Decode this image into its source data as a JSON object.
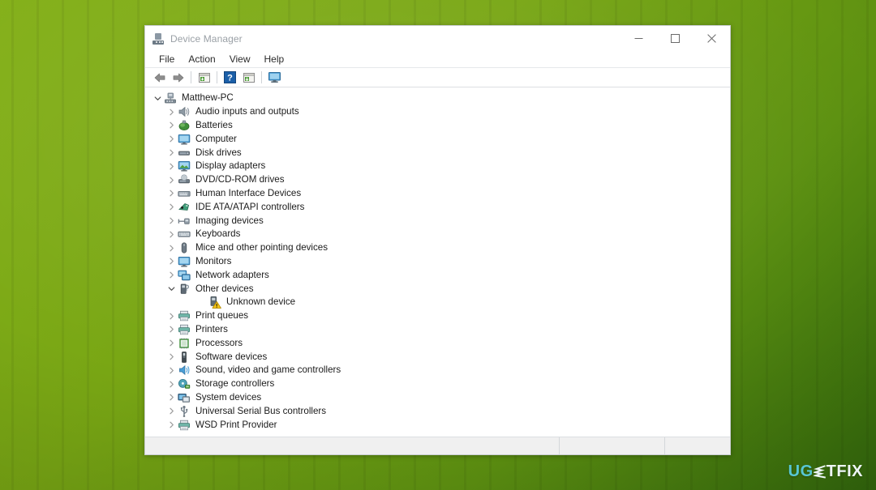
{
  "window": {
    "title": "Device Manager",
    "title_icon": "device-manager-icon",
    "controls": {
      "minimize": "minimize-button",
      "maximize": "maximize-button",
      "close": "close-button"
    }
  },
  "menubar": {
    "items": [
      {
        "label": "File"
      },
      {
        "label": "Action"
      },
      {
        "label": "View"
      },
      {
        "label": "Help"
      }
    ]
  },
  "toolbar": {
    "buttons": [
      {
        "name": "back-arrow-icon",
        "tooltip": "Back"
      },
      {
        "name": "forward-arrow-icon",
        "tooltip": "Forward"
      },
      {
        "name": "properties-icon",
        "tooltip": "Properties"
      },
      {
        "name": "help-icon",
        "tooltip": "Help"
      },
      {
        "name": "update-driver-icon",
        "tooltip": "Update Driver Software"
      },
      {
        "name": "scan-hardware-changes-icon",
        "tooltip": "Scan for hardware changes"
      }
    ]
  },
  "tree": {
    "root": {
      "label": "Matthew-PC",
      "icon": "computer-root-icon",
      "expanded": true
    },
    "items": [
      {
        "label": "Audio inputs and outputs",
        "icon": "speaker-icon",
        "depth": 1,
        "expandable": true,
        "expanded": false
      },
      {
        "label": "Batteries",
        "icon": "battery-icon",
        "depth": 1,
        "expandable": true,
        "expanded": false
      },
      {
        "label": "Computer",
        "icon": "monitor-icon",
        "depth": 1,
        "expandable": true,
        "expanded": false
      },
      {
        "label": "Disk drives",
        "icon": "disk-drive-icon",
        "depth": 1,
        "expandable": true,
        "expanded": false
      },
      {
        "label": "Display adapters",
        "icon": "display-adapter-icon",
        "depth": 1,
        "expandable": true,
        "expanded": false
      },
      {
        "label": "DVD/CD-ROM drives",
        "icon": "dvd-drive-icon",
        "depth": 1,
        "expandable": true,
        "expanded": false
      },
      {
        "label": "Human Interface Devices",
        "icon": "hid-icon",
        "depth": 1,
        "expandable": true,
        "expanded": false
      },
      {
        "label": "IDE ATA/ATAPI controllers",
        "icon": "ide-controller-icon",
        "depth": 1,
        "expandable": true,
        "expanded": false
      },
      {
        "label": "Imaging devices",
        "icon": "imaging-device-icon",
        "depth": 1,
        "expandable": true,
        "expanded": false
      },
      {
        "label": "Keyboards",
        "icon": "keyboard-icon",
        "depth": 1,
        "expandable": true,
        "expanded": false
      },
      {
        "label": "Mice and other pointing devices",
        "icon": "mouse-icon",
        "depth": 1,
        "expandable": true,
        "expanded": false
      },
      {
        "label": "Monitors",
        "icon": "monitor-icon",
        "depth": 1,
        "expandable": true,
        "expanded": false
      },
      {
        "label": "Network adapters",
        "icon": "network-adapter-icon",
        "depth": 1,
        "expandable": true,
        "expanded": false
      },
      {
        "label": "Other devices",
        "icon": "other-device-icon",
        "depth": 1,
        "expandable": true,
        "expanded": true
      },
      {
        "label": "Unknown device",
        "icon": "unknown-device-warning-icon",
        "depth": 2,
        "expandable": false,
        "expanded": false
      },
      {
        "label": "Print queues",
        "icon": "printer-icon",
        "depth": 1,
        "expandable": true,
        "expanded": false
      },
      {
        "label": "Printers",
        "icon": "printer-icon",
        "depth": 1,
        "expandable": true,
        "expanded": false
      },
      {
        "label": "Processors",
        "icon": "processor-icon",
        "depth": 1,
        "expandable": true,
        "expanded": false
      },
      {
        "label": "Software devices",
        "icon": "software-device-icon",
        "depth": 1,
        "expandable": true,
        "expanded": false
      },
      {
        "label": "Sound, video and game controllers",
        "icon": "sound-controller-icon",
        "depth": 1,
        "expandable": true,
        "expanded": false
      },
      {
        "label": "Storage controllers",
        "icon": "storage-controller-icon",
        "depth": 1,
        "expandable": true,
        "expanded": false
      },
      {
        "label": "System devices",
        "icon": "system-device-icon",
        "depth": 1,
        "expandable": true,
        "expanded": false
      },
      {
        "label": "Universal Serial Bus controllers",
        "icon": "usb-controller-icon",
        "depth": 1,
        "expandable": true,
        "expanded": false
      },
      {
        "label": "WSD Print Provider",
        "icon": "printer-icon",
        "depth": 1,
        "expandable": true,
        "expanded": false
      }
    ]
  },
  "statusbar": {
    "pane1": "",
    "pane2": "",
    "pane3": ""
  },
  "watermark": {
    "part1": "UG",
    "bolt": "lightning-bolt-e",
    "part2": "TFIX",
    "color_accent": "#57c7d4",
    "color_light": "#eef6f7"
  },
  "colors": {
    "backdrop_green": "#76a312",
    "backdrop_dark_green": "#33690c",
    "window_bg": "#ffffff",
    "title_text": "#9aa0a6",
    "status_bg": "#f0f0f0",
    "warning_yellow": "#ffcc33",
    "help_blue": "#1a5fb4"
  }
}
